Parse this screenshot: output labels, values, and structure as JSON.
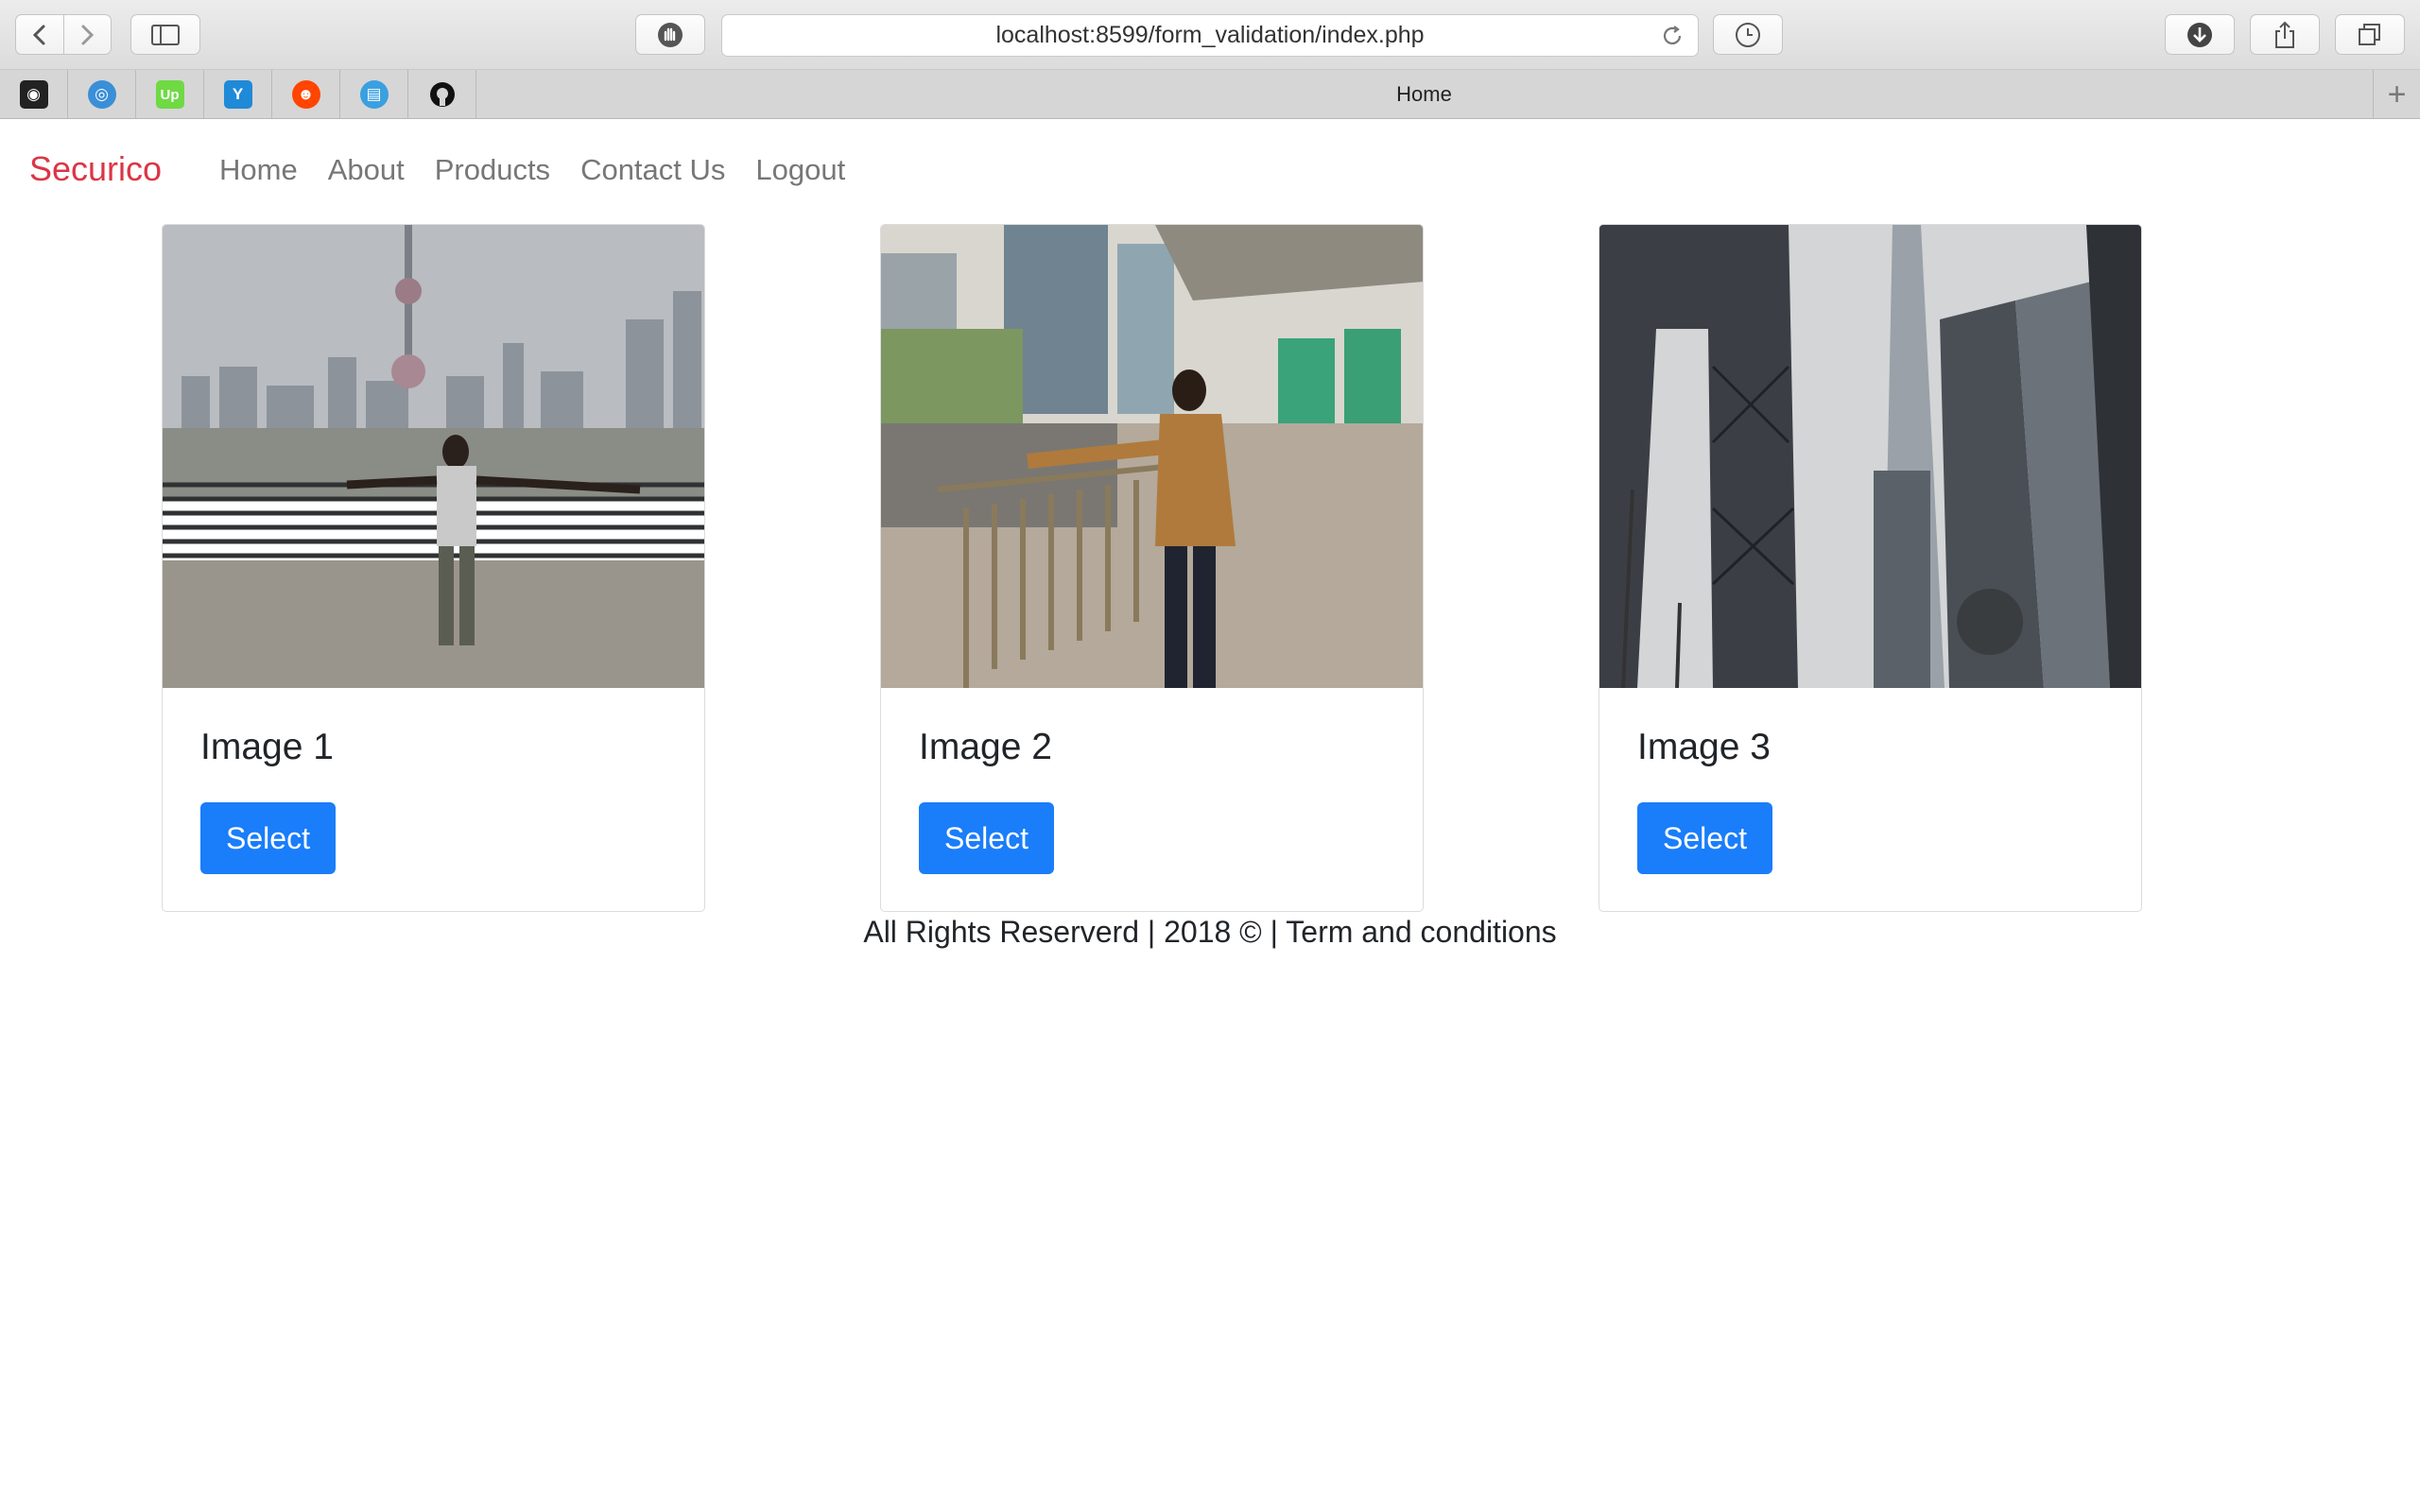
{
  "browser": {
    "url": "localhost:8599/form_validation/index.php",
    "tab_title": "Home",
    "bookmarks": [
      {
        "name": "unknown-app-icon",
        "color": "#222222",
        "glyph": "◉"
      },
      {
        "name": "target-icon",
        "color": "#3a8fd8",
        "glyph": "◎"
      },
      {
        "name": "upwork-icon",
        "color": "#6fda44",
        "glyph": "Up"
      },
      {
        "name": "yoast-icon",
        "color": "#1f8ad8",
        "glyph": "Y"
      },
      {
        "name": "reddit-icon",
        "color": "#ff4500",
        "glyph": "☻"
      },
      {
        "name": "chat-icon",
        "color": "#3aa0e0",
        "glyph": "▤"
      },
      {
        "name": "github-icon",
        "color": "#111111",
        "glyph": "●"
      }
    ]
  },
  "nav": {
    "brand": "Securico",
    "links": [
      "Home",
      "About",
      "Products",
      "Contact Us",
      "Logout"
    ]
  },
  "cards": [
    {
      "title": "Image 1",
      "button": "Select"
    },
    {
      "title": "Image 2",
      "button": "Select"
    },
    {
      "title": "Image 3",
      "button": "Select"
    }
  ],
  "footer": {
    "text": "All Rights Reserverd | 2018 © | Term and conditions"
  }
}
